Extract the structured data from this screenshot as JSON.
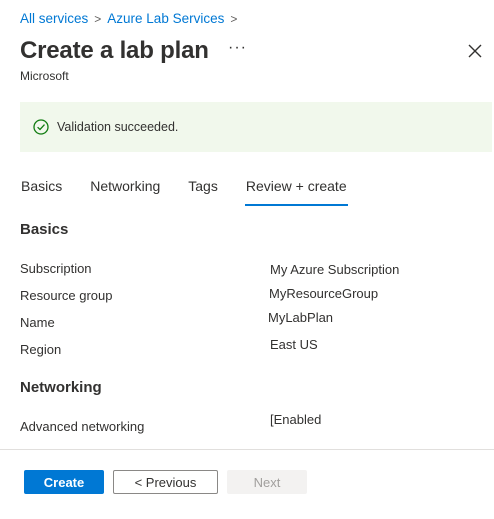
{
  "breadcrumb": {
    "items": [
      "All services",
      "Azure Lab Services"
    ],
    "separator": ">"
  },
  "header": {
    "title": "Create a lab plan",
    "more_label": "···",
    "subtitle": "Microsoft"
  },
  "banner": {
    "message": "Validation succeeded.",
    "icon": "check-circle-icon",
    "color": "#107c10"
  },
  "tabs": [
    {
      "label": "Basics",
      "active": false
    },
    {
      "label": "Networking",
      "active": false
    },
    {
      "label": "Tags",
      "active": false
    },
    {
      "label": "Review + create",
      "active": true
    }
  ],
  "review": {
    "basics": {
      "heading": "Basics",
      "rows": [
        {
          "label": "Subscription",
          "value": "My Azure Subscription"
        },
        {
          "label": "Resource group",
          "value": "MyResourceGroup"
        },
        {
          "label": "Name",
          "value": "MyLabPlan"
        },
        {
          "label": "Region",
          "value": "East US"
        }
      ]
    },
    "networking": {
      "heading": "Networking",
      "rows": [
        {
          "label": "Advanced networking",
          "value": "[Enabled"
        }
      ]
    }
  },
  "footer": {
    "create_label": "Create",
    "previous_label": "< Previous",
    "next_label": "Next"
  },
  "colors": {
    "accent": "#0078d4",
    "success_bg": "#f1f8ec"
  }
}
